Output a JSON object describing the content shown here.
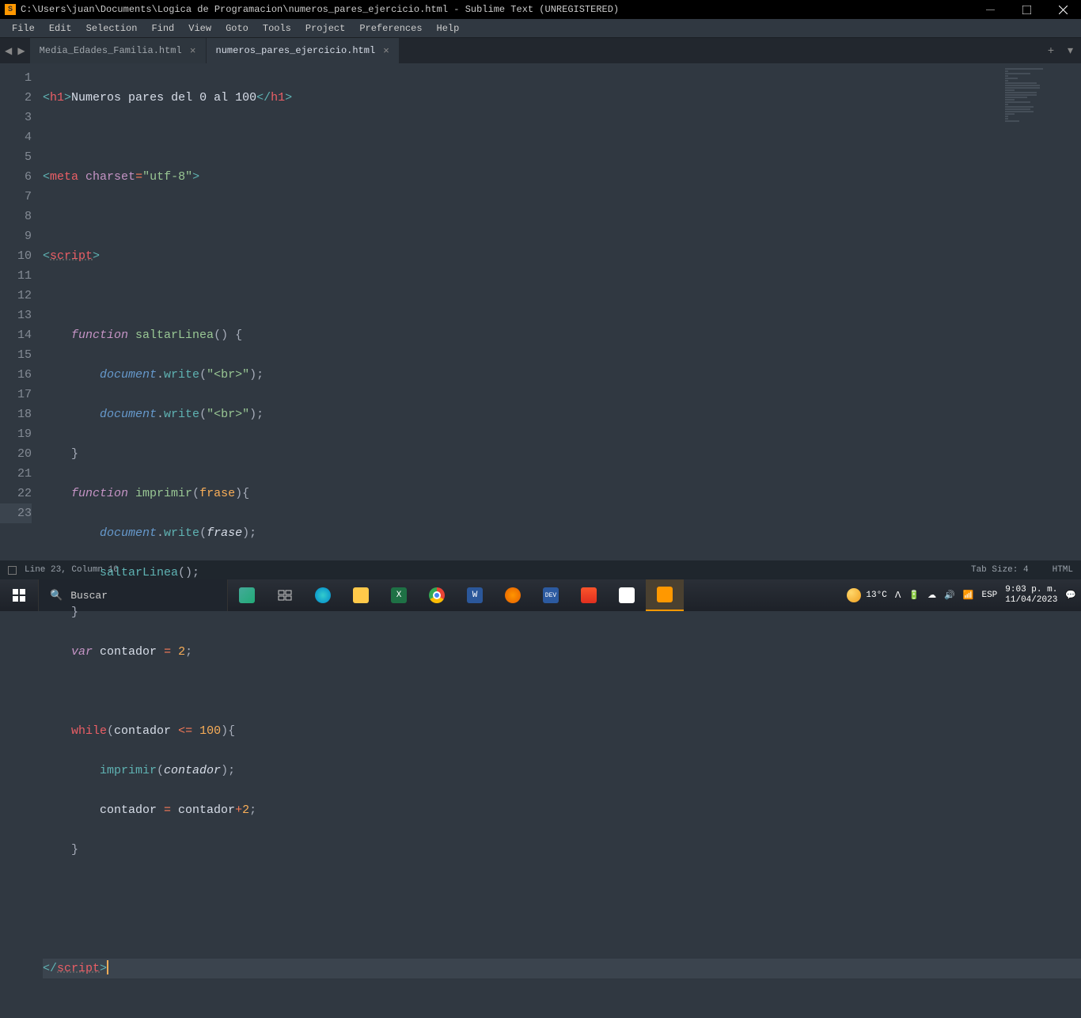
{
  "titlebar": {
    "title": "C:\\Users\\juan\\Documents\\Logica de Programacion\\numeros_pares_ejercicio.html - Sublime Text (UNREGISTERED)"
  },
  "menubar": [
    "File",
    "Edit",
    "Selection",
    "Find",
    "View",
    "Goto",
    "Tools",
    "Project",
    "Preferences",
    "Help"
  ],
  "tabs": {
    "inactive": "Media_Edades_Familia.html",
    "active": "numeros_pares_ejercicio.html"
  },
  "code": {
    "l1": {
      "h1o": "h1",
      "text": "Numeros pares del 0 al 100",
      "h1c": "h1"
    },
    "l3": {
      "tag": "meta",
      "attr": "charset",
      "eq": "=",
      "val": "\"utf-8\""
    },
    "l5": {
      "tag": "script"
    },
    "l7": {
      "kw": "function",
      "name": "saltarLinea",
      "paren": "() {"
    },
    "l8": {
      "obj": "document",
      "dot": ".",
      "fn": "write",
      "open": "(",
      "str": "\"<br>\"",
      "close": ");"
    },
    "l9": {
      "obj": "document",
      "dot": ".",
      "fn": "write",
      "open": "(",
      "str": "\"<br>\"",
      "close": ");"
    },
    "l10": {
      "brace": "}"
    },
    "l11": {
      "kw": "function",
      "name": "imprimir",
      "open": "(",
      "param": "frase",
      "close": "){"
    },
    "l12": {
      "obj": "document",
      "dot": ".",
      "fn": "write",
      "open": "(",
      "param": "frase",
      "close": ");"
    },
    "l13": {
      "fn": "saltarLinea",
      "call": "();"
    },
    "l14": {
      "brace": "}"
    },
    "l15": {
      "kw": "var",
      "var": "contador",
      "op": " = ",
      "num": "2",
      "semi": ";"
    },
    "l17": {
      "kw": "while",
      "open": "(",
      "var": "contador",
      "cmp": " <= ",
      "num": "100",
      "close": "){"
    },
    "l18": {
      "fn": "imprimir",
      "open": "(",
      "var": "contador",
      "close": ");"
    },
    "l19": {
      "var1": "contador",
      "op": " = ",
      "var2": "contador",
      "plus": "+",
      "num": "2",
      "semi": ";"
    },
    "l20": {
      "brace": "}"
    },
    "l23": {
      "tag": "script"
    }
  },
  "statusbar": {
    "left": "Line 23, Column 10",
    "tabsize": "Tab Size: 4",
    "lang": "HTML"
  },
  "taskbar": {
    "search_placeholder": "Buscar",
    "weather_temp": "13°C",
    "lang": "ESP",
    "time": "9:03 p. m.",
    "date": "11/04/2023"
  }
}
